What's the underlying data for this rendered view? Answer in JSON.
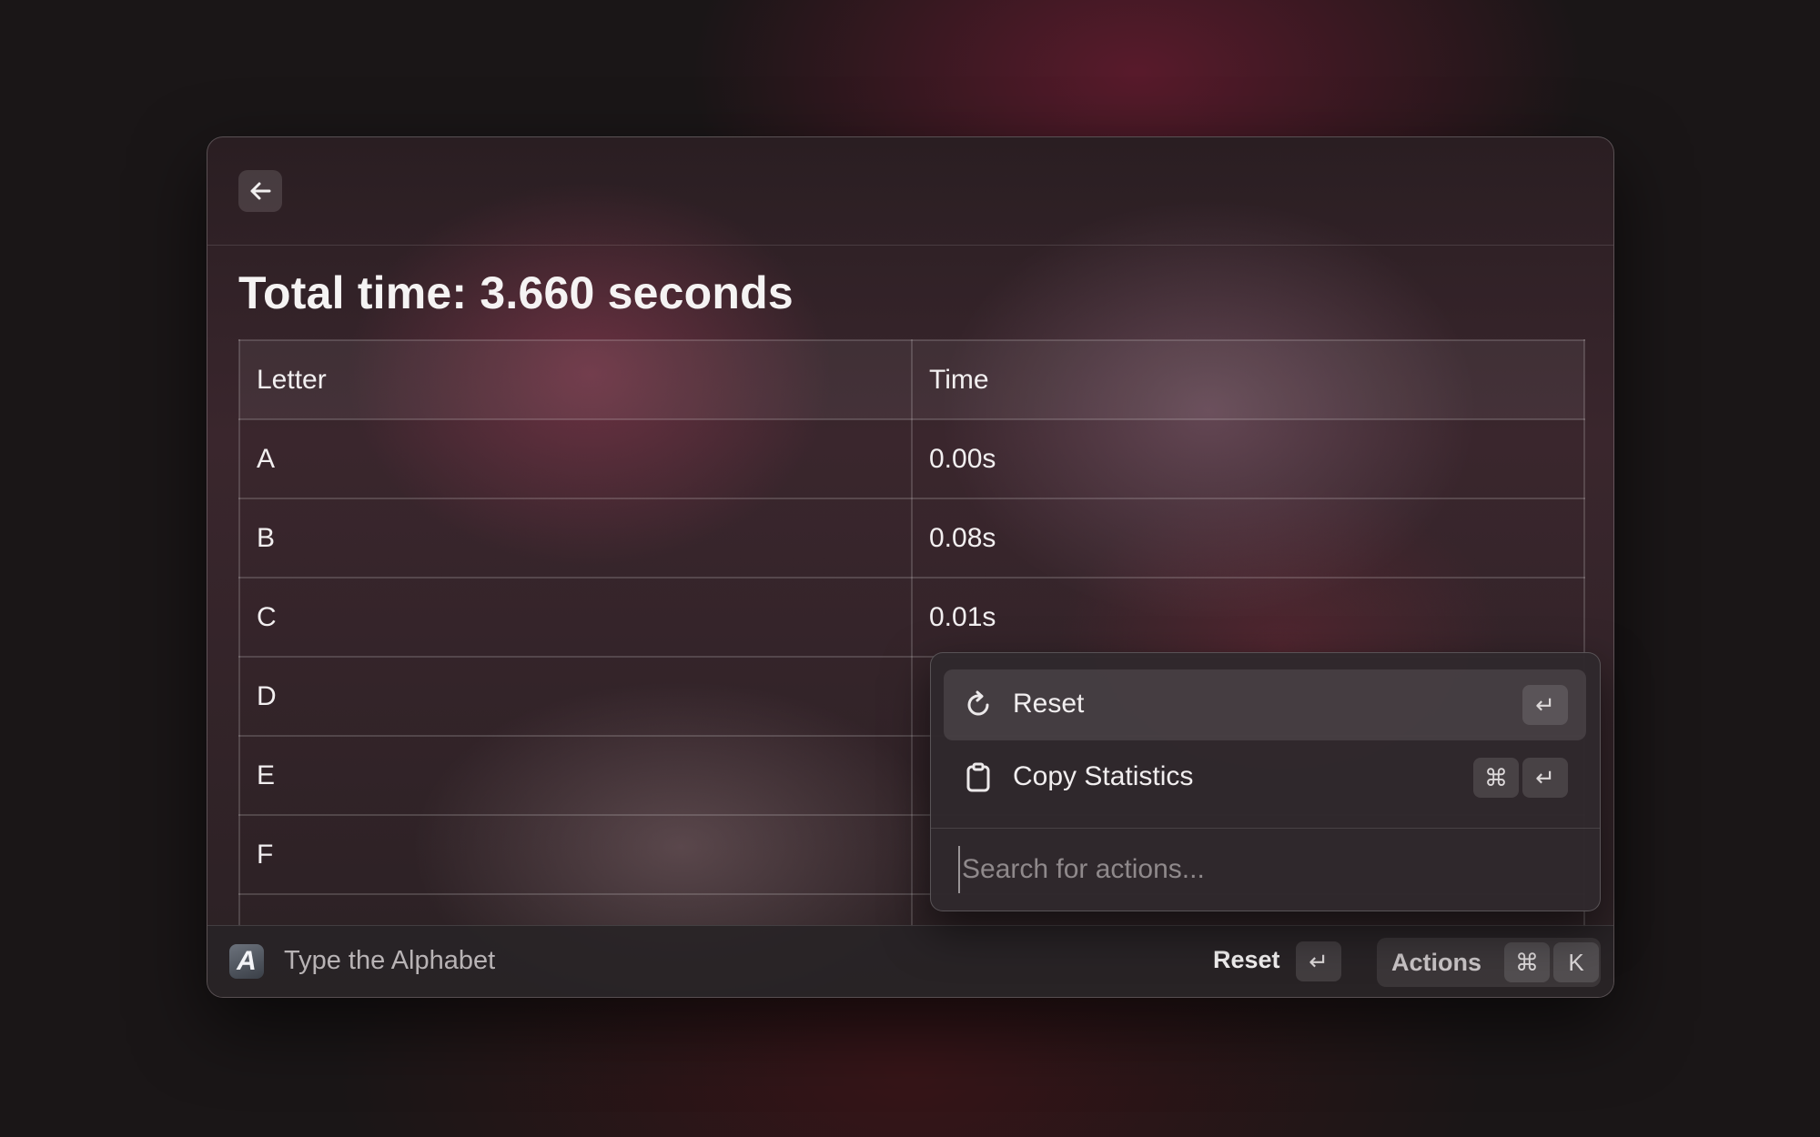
{
  "window": {
    "back_icon": "arrow-left-icon",
    "title": "Total time: 3.660 seconds"
  },
  "table": {
    "headers": [
      "Letter",
      "Time"
    ],
    "rows": [
      {
        "letter": "A",
        "time": "0.00s"
      },
      {
        "letter": "B",
        "time": "0.08s"
      },
      {
        "letter": "C",
        "time": "0.01s"
      },
      {
        "letter": "D",
        "time": ""
      },
      {
        "letter": "E",
        "time": ""
      },
      {
        "letter": "F",
        "time": ""
      },
      {
        "letter": "",
        "time": ""
      }
    ]
  },
  "popup": {
    "items": [
      {
        "label": "Reset",
        "icon": "refresh-icon",
        "keys": [
          "↵"
        ]
      },
      {
        "label": "Copy Statistics",
        "icon": "clipboard-icon",
        "keys": [
          "⌘",
          "↵"
        ]
      }
    ],
    "search_placeholder": "Search for actions..."
  },
  "statusbar": {
    "app_icon_letter": "A",
    "app_name": "Type the Alphabet",
    "primary_action": "Reset",
    "primary_key": "↵",
    "actions_label": "Actions",
    "actions_keys": [
      "⌘",
      "K"
    ]
  }
}
